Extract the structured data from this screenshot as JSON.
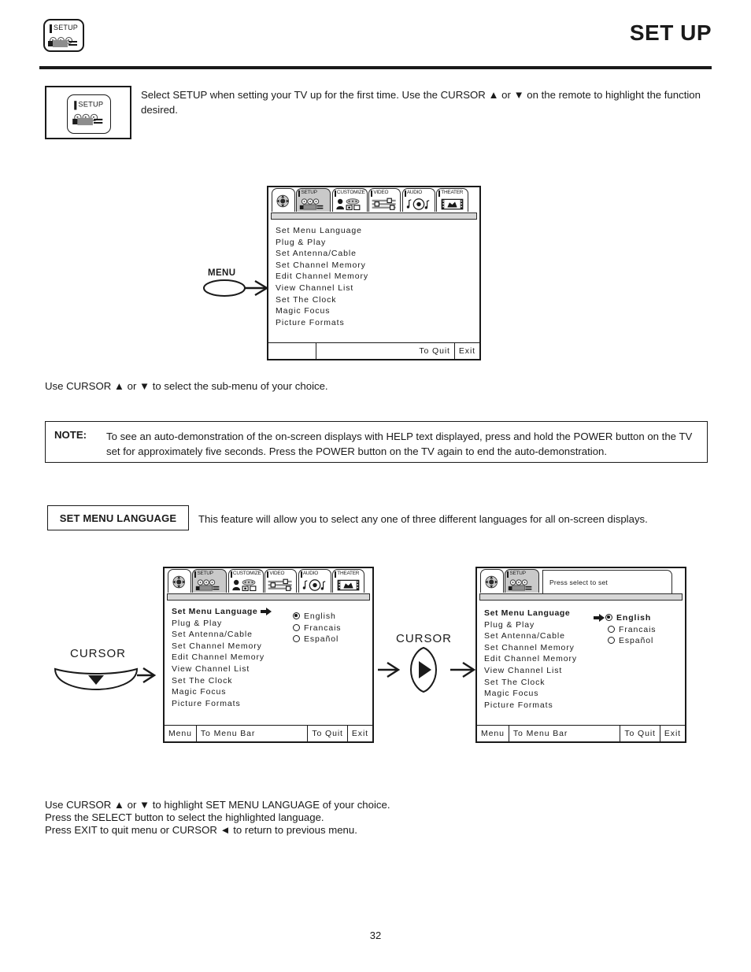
{
  "header": {
    "title": "SET UP",
    "icon": "setup-remote-icon"
  },
  "intro": {
    "icon": "setup-remote-icon",
    "text": "Select SETUP when setting your TV up for the first time.  Use the CURSOR ▲ or ▼ on the remote to highlight the function desired."
  },
  "menu_tabs": [
    {
      "label": "",
      "icon": "cursor-pad-icon",
      "active": false
    },
    {
      "label": "SETUP",
      "icon": "setup-remote-icon",
      "active": true
    },
    {
      "label": "CUSTOMIZE",
      "icon": "person-devices-icon",
      "active": false
    },
    {
      "label": "VIDEO",
      "icon": "sliders-icon",
      "active": false
    },
    {
      "label": "AUDIO",
      "icon": "speaker-notes-icon",
      "active": false
    },
    {
      "label": "THEATER",
      "icon": "film-strip-icon",
      "active": false
    }
  ],
  "osd_items": [
    "Set Menu Language",
    "Plug & Play",
    "Set Antenna/Cable",
    "Set Channel Memory",
    "Edit Channel Memory",
    "View Channel List",
    "Set The Clock",
    "Magic Focus",
    "Picture Formats"
  ],
  "language_options": [
    {
      "label": "English",
      "selected": true
    },
    {
      "label": "Francais",
      "selected": false
    },
    {
      "label": "Español",
      "selected": false
    }
  ],
  "tv_top": {
    "footer": {
      "left": "",
      "menu_bar": "",
      "to_quit": "To Quit",
      "exit": "Exit"
    }
  },
  "tv_left": {
    "footer": {
      "menu": "Menu",
      "menu_bar": "To Menu Bar",
      "to_quit": "To Quit",
      "exit": "Exit"
    }
  },
  "tv_right": {
    "help_text": "Press select to set",
    "footer": {
      "menu": "Menu",
      "menu_bar": "To Menu Bar",
      "to_quit": "To Quit",
      "exit": "Exit"
    }
  },
  "callouts": {
    "menu": "MENU",
    "cursor_down": "CURSOR",
    "cursor_right": "CURSOR"
  },
  "paragraphs": {
    "after_top_menu": "Use CURSOR ▲ or ▼ to select the sub-menu of your choice.",
    "bottom_line1": "Use CURSOR ▲ or ▼ to highlight SET MENU LANGUAGE of your choice.",
    "bottom_line2": "Press the SELECT button to select the highlighted language.",
    "bottom_line3": "Press EXIT to quit menu or CURSOR ◄ to return to previous menu."
  },
  "note": {
    "label": "NOTE:",
    "text": "To see an auto-demonstration of the on-screen displays with HELP text displayed, press and hold the POWER button on the TV set for approximately five seconds. Press the POWER button on the TV again to end the auto-demonstration."
  },
  "set_menu_language": {
    "label": "SET MENU LANGUAGE",
    "description": "This feature will allow you to select any one of three different languages for all on-screen displays."
  },
  "page_number": "32",
  "colors": {
    "ink": "#1a1a1a",
    "tab_active": "#c9c9c9",
    "subbar": "#d7d7d7"
  }
}
